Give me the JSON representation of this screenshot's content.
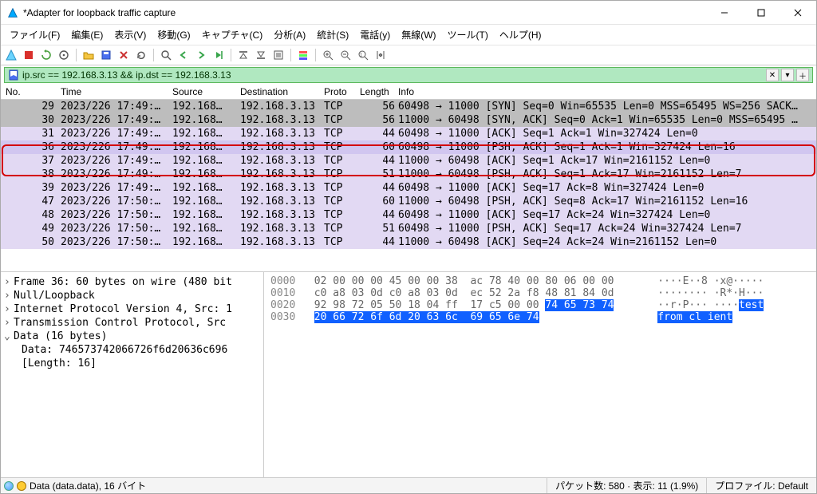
{
  "window": {
    "title": "*Adapter for loopback traffic capture"
  },
  "menu": [
    "ファイル(F)",
    "編集(E)",
    "表示(V)",
    "移動(G)",
    "キャプチャ(C)",
    "分析(A)",
    "統計(S)",
    "電話(y)",
    "無線(W)",
    "ツール(T)",
    "ヘルプ(H)"
  ],
  "filter": {
    "value": "ip.src == 192.168.3.13 && ip.dst == 192.168.3.13"
  },
  "columns": {
    "no": "No.",
    "time": "Time",
    "source": "Source",
    "destination": "Destination",
    "proto": "Proto",
    "length": "Length",
    "info": "Info"
  },
  "packets": [
    {
      "no": "29",
      "time": "2023/226 17:49:…",
      "src": "192.168…",
      "dst": "192.168.3.13",
      "proto": "TCP",
      "len": "56",
      "info": "60498 → 11000 [SYN] Seq=0 Win=65535 Len=0 MSS=65495 WS=256 SACK…",
      "cls": "bg-gray"
    },
    {
      "no": "30",
      "time": "2023/226 17:49:…",
      "src": "192.168…",
      "dst": "192.168.3.13",
      "proto": "TCP",
      "len": "56",
      "info": "11000 → 60498 [SYN, ACK] Seq=0 Ack=1 Win=65535 Len=0 MSS=65495 …",
      "cls": "bg-gray"
    },
    {
      "no": "31",
      "time": "2023/226 17:49:…",
      "src": "192.168…",
      "dst": "192.168.3.13",
      "proto": "TCP",
      "len": "44",
      "info": "60498 → 11000 [ACK] Seq=1 Ack=1 Win=327424 Len=0",
      "cls": "bg-lav"
    },
    {
      "no": "36",
      "time": "2023/226 17:49:…",
      "src": "192.168…",
      "dst": "192.168.3.13",
      "proto": "TCP",
      "len": "60",
      "info": "60498 → 11000 [PSH, ACK] Seq=1 Ack=1 Win=327424 Len=16",
      "cls": "bg-sel"
    },
    {
      "no": "37",
      "time": "2023/226 17:49:…",
      "src": "192.168…",
      "dst": "192.168.3.13",
      "proto": "TCP",
      "len": "44",
      "info": "11000 → 60498 [ACK] Seq=1 Ack=17 Win=2161152 Len=0",
      "cls": "bg-lav"
    },
    {
      "no": "38",
      "time": "2023/226 17:49:…",
      "src": "192.168…",
      "dst": "192.168.3.13",
      "proto": "TCP",
      "len": "51",
      "info": "11000 → 60498 [PSH, ACK] Seq=1 Ack=17 Win=2161152 Len=7",
      "cls": "bg-lav"
    },
    {
      "no": "39",
      "time": "2023/226 17:49:…",
      "src": "192.168…",
      "dst": "192.168.3.13",
      "proto": "TCP",
      "len": "44",
      "info": "60498 → 11000 [ACK] Seq=17 Ack=8 Win=327424 Len=0",
      "cls": "bg-lav"
    },
    {
      "no": "47",
      "time": "2023/226 17:50:…",
      "src": "192.168…",
      "dst": "192.168.3.13",
      "proto": "TCP",
      "len": "60",
      "info": "11000 → 60498 [PSH, ACK] Seq=8 Ack=17 Win=2161152 Len=16",
      "cls": "bg-lav"
    },
    {
      "no": "48",
      "time": "2023/226 17:50:…",
      "src": "192.168…",
      "dst": "192.168.3.13",
      "proto": "TCP",
      "len": "44",
      "info": "60498 → 11000 [ACK] Seq=17 Ack=24 Win=327424 Len=0",
      "cls": "bg-lav"
    },
    {
      "no": "49",
      "time": "2023/226 17:50:…",
      "src": "192.168…",
      "dst": "192.168.3.13",
      "proto": "TCP",
      "len": "51",
      "info": "60498 → 11000 [PSH, ACK] Seq=17 Ack=24 Win=327424 Len=7",
      "cls": "bg-lav"
    },
    {
      "no": "50",
      "time": "2023/226 17:50:…",
      "src": "192.168…",
      "dst": "192.168.3.13",
      "proto": "TCP",
      "len": "44",
      "info": "11000 → 60498 [ACK] Seq=24 Ack=24 Win=2161152 Len=0",
      "cls": "bg-lav"
    }
  ],
  "tree": [
    {
      "label": "Frame 36: 60 bytes on wire (480 bit",
      "type": "exp"
    },
    {
      "label": "Null/Loopback",
      "type": "exp"
    },
    {
      "label": "Internet Protocol Version 4, Src: 1",
      "type": "exp"
    },
    {
      "label": "Transmission Control Protocol, Src",
      "type": "exp"
    },
    {
      "label": "Data (16 bytes)",
      "type": "col"
    },
    {
      "label": "Data: 746573742066726f6d20636c696",
      "type": "indent"
    },
    {
      "label": "[Length: 16]",
      "type": "indent"
    }
  ],
  "hex": {
    "lines": [
      {
        "off": "0000",
        "hex": "02 00 00 00 45 00 00 38  ac 78 40 00 80 06 00 00",
        "ascii": "····E··8 ·x@·····"
      },
      {
        "off": "0010",
        "hex": "c0 a8 03 0d c0 a8 03 0d  ec 52 2a f8 48 81 84 0d",
        "ascii": "········ ·R*·H···"
      },
      {
        "off": "0020",
        "hex": "92 98 72 05 50 18 04 ff  17 c5 00 00 ",
        "ascii": "··r·P··· ····",
        "hex_sel": "74 65 73 74",
        "ascii_sel": "test"
      },
      {
        "off": "0030",
        "hex_sel": "20 66 72 6f 6d 20 63 6c  69 65 6e 74",
        "ascii_sel": "from cl ient",
        "sel_all": true
      }
    ]
  },
  "status": {
    "left": "Data (data.data), 16 バイト",
    "pkt": "パケット数: 580 · 表示: 11 (1.9%)",
    "profile": "プロファイル: Default"
  }
}
